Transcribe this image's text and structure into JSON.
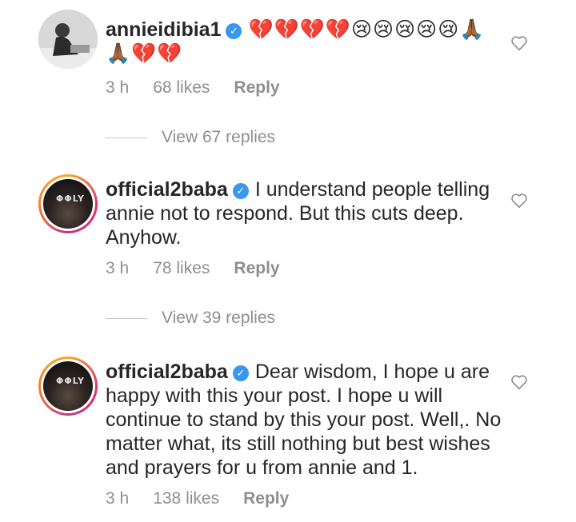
{
  "comments": [
    {
      "username": "annieidibia1",
      "text": "💔💔💔💔😢😢😢😢😢🙏🏾🙏🏾💔💔",
      "time": "3 h",
      "likes": "68 likes",
      "reply": "Reply",
      "view_replies": "View 67 replies"
    },
    {
      "username": "official2baba",
      "text": "I understand people telling annie not to respond. But this cuts deep. Anyhow.",
      "time": "3 h",
      "likes": "78 likes",
      "reply": "Reply",
      "view_replies": "View 39 replies"
    },
    {
      "username": "official2baba",
      "text": "Dear wisdom, I hope u are happy with this your post. I hope u will continue to stand by this your post.  Well,. No matter what, its still nothing but best wishes and prayers for u from annie and 1.",
      "time": "3 h",
      "likes": "138 likes",
      "reply": "Reply",
      "avatar_cap_text": "ΦΦLY"
    }
  ],
  "icons": {
    "verified": "verified-badge-icon",
    "heart": "heart-outline-icon"
  },
  "colors": {
    "text": "#262626",
    "meta": "#8e8e8e",
    "verified": "#3897f0"
  }
}
